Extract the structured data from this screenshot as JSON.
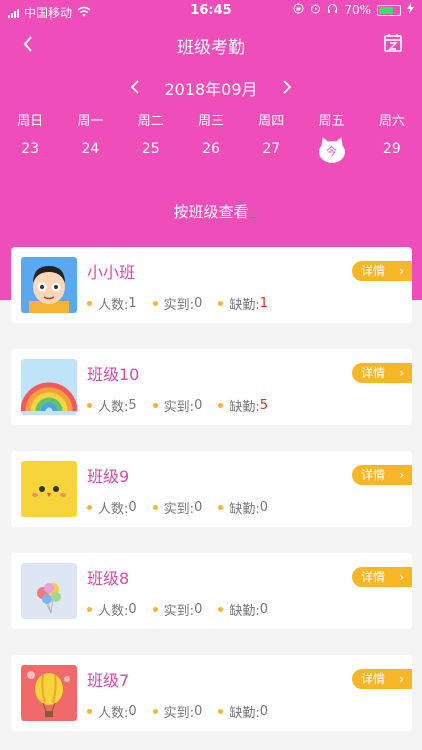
{
  "status": {
    "carrier": "中国移动",
    "time": "16:45",
    "battery_pct": "70%",
    "battery_level": 0.7
  },
  "nav": {
    "title": "班级考勤"
  },
  "calendar": {
    "month": "2018年09月",
    "weekdays": [
      "周日",
      "周一",
      "周二",
      "周三",
      "周四",
      "周五",
      "周六"
    ],
    "days": [
      "23",
      "24",
      "25",
      "26",
      "27",
      "今",
      "29"
    ]
  },
  "section_title": "按班级查看",
  "labels": {
    "detail": "详情",
    "count": "人数: ",
    "present": "实到: ",
    "absent": "缺勤: "
  },
  "classes": [
    {
      "name": "小小班",
      "count": "1",
      "present": "0",
      "absent": "1",
      "absent_highlight": true,
      "thumb": "boy-avatar"
    },
    {
      "name": "班级10",
      "count": "5",
      "present": "0",
      "absent": "5",
      "absent_highlight": true,
      "thumb": "rainbow"
    },
    {
      "name": "班级9",
      "count": "0",
      "present": "0",
      "absent": "0",
      "absent_highlight": false,
      "thumb": "chick"
    },
    {
      "name": "班级8",
      "count": "0",
      "present": "0",
      "absent": "0",
      "absent_highlight": false,
      "thumb": "balloons"
    },
    {
      "name": "班级7",
      "count": "0",
      "present": "0",
      "absent": "0",
      "absent_highlight": false,
      "thumb": "hot-air-balloon"
    }
  ],
  "colors": {
    "primary": "#ee4dba",
    "accent": "#f7b628",
    "alert": "#e02a2a"
  }
}
